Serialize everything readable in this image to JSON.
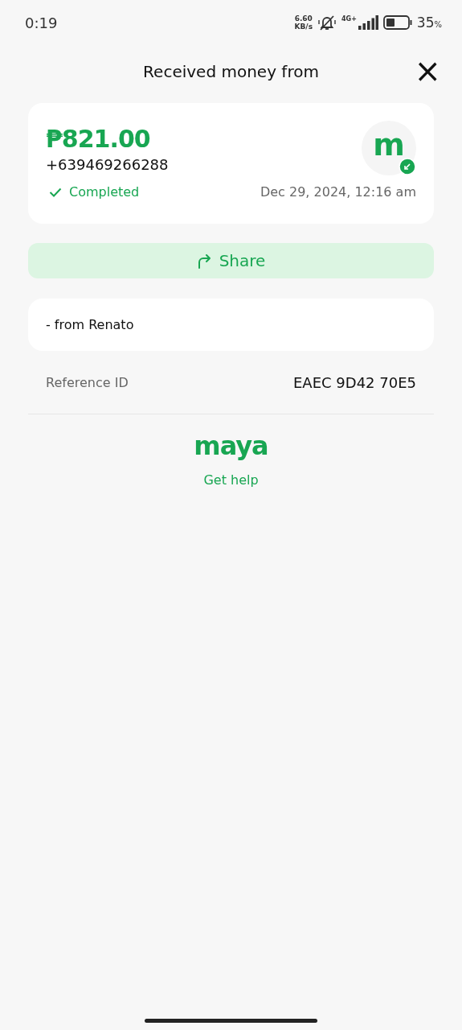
{
  "status_bar": {
    "time": "0:19",
    "net_speed": "6.60",
    "net_unit": "KB/s",
    "network": "4G+",
    "battery": "35",
    "battery_unit": "%"
  },
  "header": {
    "title": "Received money from",
    "close": "×"
  },
  "transaction": {
    "amount": "₱821.00",
    "sender": "+639469266288",
    "status": "Completed",
    "completed": true,
    "date": "Dec 29, 2024, 12:16 am",
    "avatar_letter": "m"
  },
  "share": {
    "label": "Share"
  },
  "note": "- from Renato",
  "reference": {
    "label": "Reference ID",
    "value": "EAEC 9D42 70E5"
  },
  "footer": {
    "logo": "maya",
    "help": "Get help"
  }
}
